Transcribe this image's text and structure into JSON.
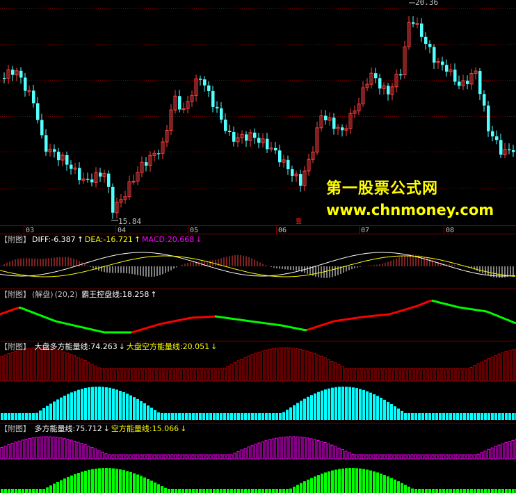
{
  "colors": {
    "up": "#ff4040",
    "down": "#54ffff",
    "grid": "#800000",
    "axis_text": "#c0c0c0",
    "diff_line": "#ffffff",
    "dea_line": "#ffff00",
    "macd_bar": "#ff00ff",
    "green_line": "#00ff00",
    "red_line": "#ff0000",
    "magenta": "#ff00ff",
    "bright_green": "#00ff00",
    "cyan": "#00ffff",
    "dark_red": "#c00000"
  },
  "main_chart": {
    "high_label": "20.36",
    "low_label": "15.84",
    "months": [
      "03",
      "04",
      "05",
      "06",
      "07",
      "08"
    ],
    "marker": "壹"
  },
  "watermark": {
    "line1": "第一股票公式网",
    "line2": "www.chnmoney.com"
  },
  "macd_panel": {
    "prefix": "【附图】",
    "diff_label": "DIFF:-6.387",
    "diff_arrow": "↑",
    "dea_label": "DEA:-16.721",
    "dea_arrow": "↑",
    "macd_label": "MACD:20.668",
    "macd_arrow": "↓"
  },
  "control_panel": {
    "prefix": "【附图】",
    "name": "(解盘)",
    "params": "(20,2)",
    "value_label": "霸王控盘线:18.258",
    "value_arrow": "↑"
  },
  "market_energy_panel": {
    "prefix": "【附图】",
    "long_label": "大盘多方能量线:74.263",
    "long_arrow": "↓",
    "short_label": "大盘空方能量线:20.051",
    "short_arrow": "↓"
  },
  "energy_panel": {
    "prefix": "【附图】",
    "long_label": "多方能量线:75.712",
    "long_arrow": "↓",
    "short_label": "空方能量线:15.066",
    "short_arrow": "↓"
  }
}
